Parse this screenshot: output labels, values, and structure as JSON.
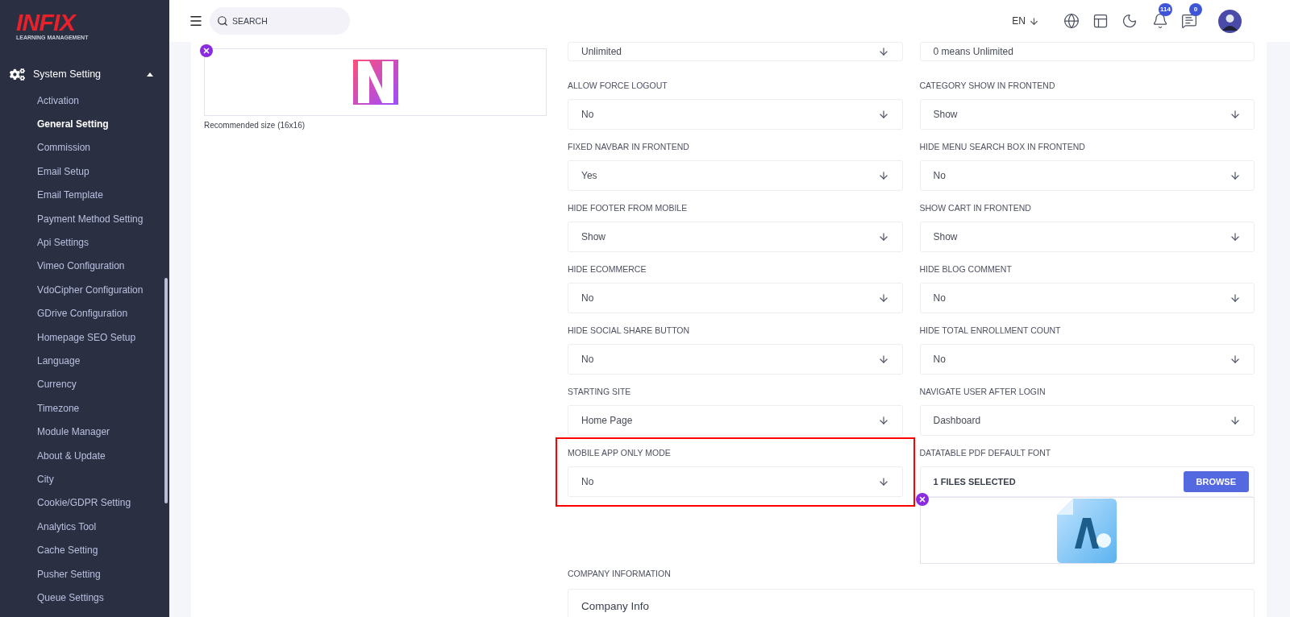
{
  "brand": {
    "name": "INFIX",
    "tagline": "LEARNING MANAGEMENT"
  },
  "sidebar": {
    "section": {
      "label": "System Setting",
      "expanded": true
    },
    "items": [
      {
        "label": "Activation",
        "selected": false
      },
      {
        "label": "General Setting",
        "selected": true
      },
      {
        "label": "Commission",
        "selected": false
      },
      {
        "label": "Email Setup",
        "selected": false
      },
      {
        "label": "Email Template",
        "selected": false
      },
      {
        "label": "Payment Method Setting",
        "selected": false
      },
      {
        "label": "Api Settings",
        "selected": false
      },
      {
        "label": "Vimeo Configuration",
        "selected": false
      },
      {
        "label": "VdoCipher Configuration",
        "selected": false
      },
      {
        "label": "GDrive Configuration",
        "selected": false
      },
      {
        "label": "Homepage SEO Setup",
        "selected": false
      },
      {
        "label": "Language",
        "selected": false
      },
      {
        "label": "Currency",
        "selected": false
      },
      {
        "label": "Timezone",
        "selected": false
      },
      {
        "label": "Module Manager",
        "selected": false
      },
      {
        "label": "About & Update",
        "selected": false
      },
      {
        "label": "City",
        "selected": false
      },
      {
        "label": "Cookie/GDPR Setting",
        "selected": false
      },
      {
        "label": "Analytics Tool",
        "selected": false
      },
      {
        "label": "Cache Setting",
        "selected": false
      },
      {
        "label": "Pusher Setting",
        "selected": false
      },
      {
        "label": "Queue Settings",
        "selected": false
      }
    ]
  },
  "header": {
    "search": {
      "placeholder": "SEARCH"
    },
    "language": "EN",
    "notifications": {
      "count": "114"
    },
    "messages": {
      "count": "0"
    }
  },
  "left_panel": {
    "caption": "Recommended size (16x16)"
  },
  "top_row": [
    {
      "kind": "select",
      "value": "Unlimited"
    },
    {
      "kind": "input",
      "value": "0 means Unlimited"
    }
  ],
  "settings": [
    {
      "kind": "select",
      "label": "ALLOW FORCE LOGOUT",
      "value": "No",
      "highlighted": false
    },
    {
      "kind": "select",
      "label": "CATEGORY SHOW IN FRONTEND",
      "value": "Show",
      "highlighted": false
    },
    {
      "kind": "select",
      "label": "FIXED NAVBAR IN FRONTEND",
      "value": "Yes",
      "highlighted": false
    },
    {
      "kind": "select",
      "label": "HIDE MENU SEARCH BOX IN FRONTEND",
      "value": "No",
      "highlighted": false
    },
    {
      "kind": "select",
      "label": "HIDE FOOTER FROM MOBILE",
      "value": "Show",
      "highlighted": false
    },
    {
      "kind": "select",
      "label": "SHOW CART IN FRONTEND",
      "value": "Show",
      "highlighted": false
    },
    {
      "kind": "select",
      "label": "HIDE ECOMMERCE",
      "value": "No",
      "highlighted": false
    },
    {
      "kind": "select",
      "label": "HIDE BLOG COMMENT",
      "value": "No",
      "highlighted": false
    },
    {
      "kind": "select",
      "label": "HIDE SOCIAL SHARE BUTTON",
      "value": "No",
      "highlighted": false
    },
    {
      "kind": "select",
      "label": "HIDE TOTAL ENROLLMENT COUNT",
      "value": "No",
      "highlighted": false
    },
    {
      "kind": "select",
      "label": "STARTING SITE",
      "value": "Home Page",
      "highlighted": false
    },
    {
      "kind": "select",
      "label": "NAVIGATE USER AFTER LOGIN",
      "value": "Dashboard",
      "highlighted": false
    },
    {
      "kind": "select",
      "label": "MOBILE APP ONLY MODE",
      "value": "No",
      "highlighted": true
    },
    {
      "kind": "file",
      "label": "DATATABLE PDF DEFAULT FONT",
      "value": "1 FILES SELECTED",
      "button": "BROWSE",
      "highlighted": false
    }
  ],
  "company_information": {
    "label": "COMPANY INFORMATION",
    "value": "Company Info"
  }
}
